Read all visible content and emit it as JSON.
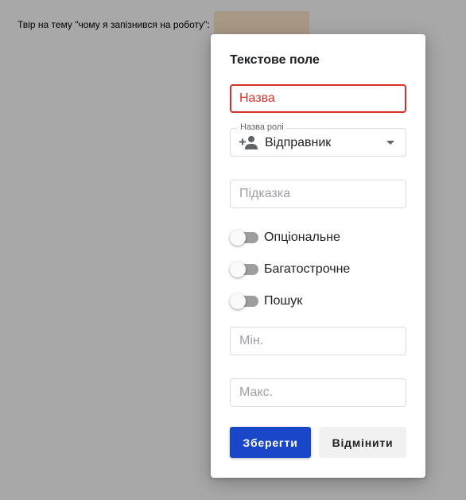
{
  "document": {
    "prompt_text": "Твір на тему \"чому я запізнився на роботу\":"
  },
  "dialog": {
    "title": "Текстове поле",
    "name_field": {
      "placeholder": "Назва",
      "value": ""
    },
    "role_field": {
      "label": "Назва ролі",
      "value": "Відправник",
      "icon": "person-add-icon"
    },
    "hint_field": {
      "placeholder": "Підказка",
      "value": ""
    },
    "toggles": {
      "optional": {
        "label": "Опціональне",
        "checked": false
      },
      "multiline": {
        "label": "Багатострочне",
        "checked": false
      },
      "search": {
        "label": "Пошук",
        "checked": false
      }
    },
    "min_field": {
      "placeholder": "Мін.",
      "value": ""
    },
    "max_field": {
      "placeholder": "Макс.",
      "value": ""
    },
    "buttons": {
      "save": "Зберегти",
      "cancel": "Відмінити"
    }
  },
  "colors": {
    "primary": "#1a47c9",
    "error": "#d93025",
    "field_highlight": "#ffe8cc"
  }
}
